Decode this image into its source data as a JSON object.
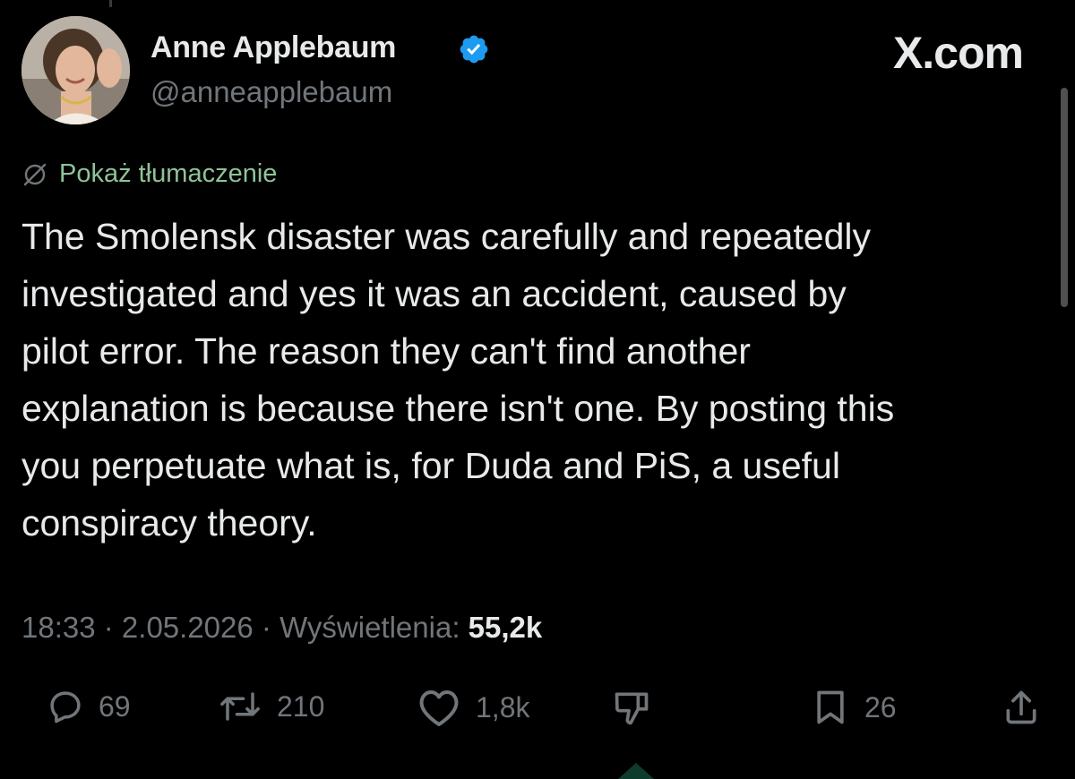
{
  "author": {
    "display_name": "Anne Applebaum",
    "handle": "@anneapplebaum",
    "verified": true
  },
  "brand": "X.com",
  "translate": {
    "label": "Pokaż tłumaczenie",
    "icon": "globe-slash-icon"
  },
  "tweet": {
    "text": "The Smolensk disaster was carefully and repeatedly\ninvestigated and yes it was an accident, caused by\npilot error.  The reason they can't find another\nexplanation is because there isn't one. By posting this\nyou perpetuate what is, for Duda and PiS, a useful\nconspiracy theory."
  },
  "meta": {
    "time": "18:33",
    "separator": " · ",
    "date": "2.05.2026",
    "views_label": "Wyświetlenia:",
    "views_count": "55,2k"
  },
  "actions": {
    "reply": {
      "icon": "reply-icon",
      "count": "69"
    },
    "repost": {
      "icon": "repost-icon",
      "count": "210"
    },
    "like": {
      "icon": "heart-icon",
      "count": "1,8k"
    },
    "dislike": {
      "icon": "thumbs-down-icon"
    },
    "bookmark": {
      "icon": "bookmark-icon",
      "count": "26"
    },
    "share": {
      "icon": "share-icon"
    }
  },
  "colors": {
    "background": "#000000",
    "text": "#e7e9ea",
    "muted": "#71767b",
    "verified": "#1d9bf0",
    "translate": "#8fc39a"
  }
}
